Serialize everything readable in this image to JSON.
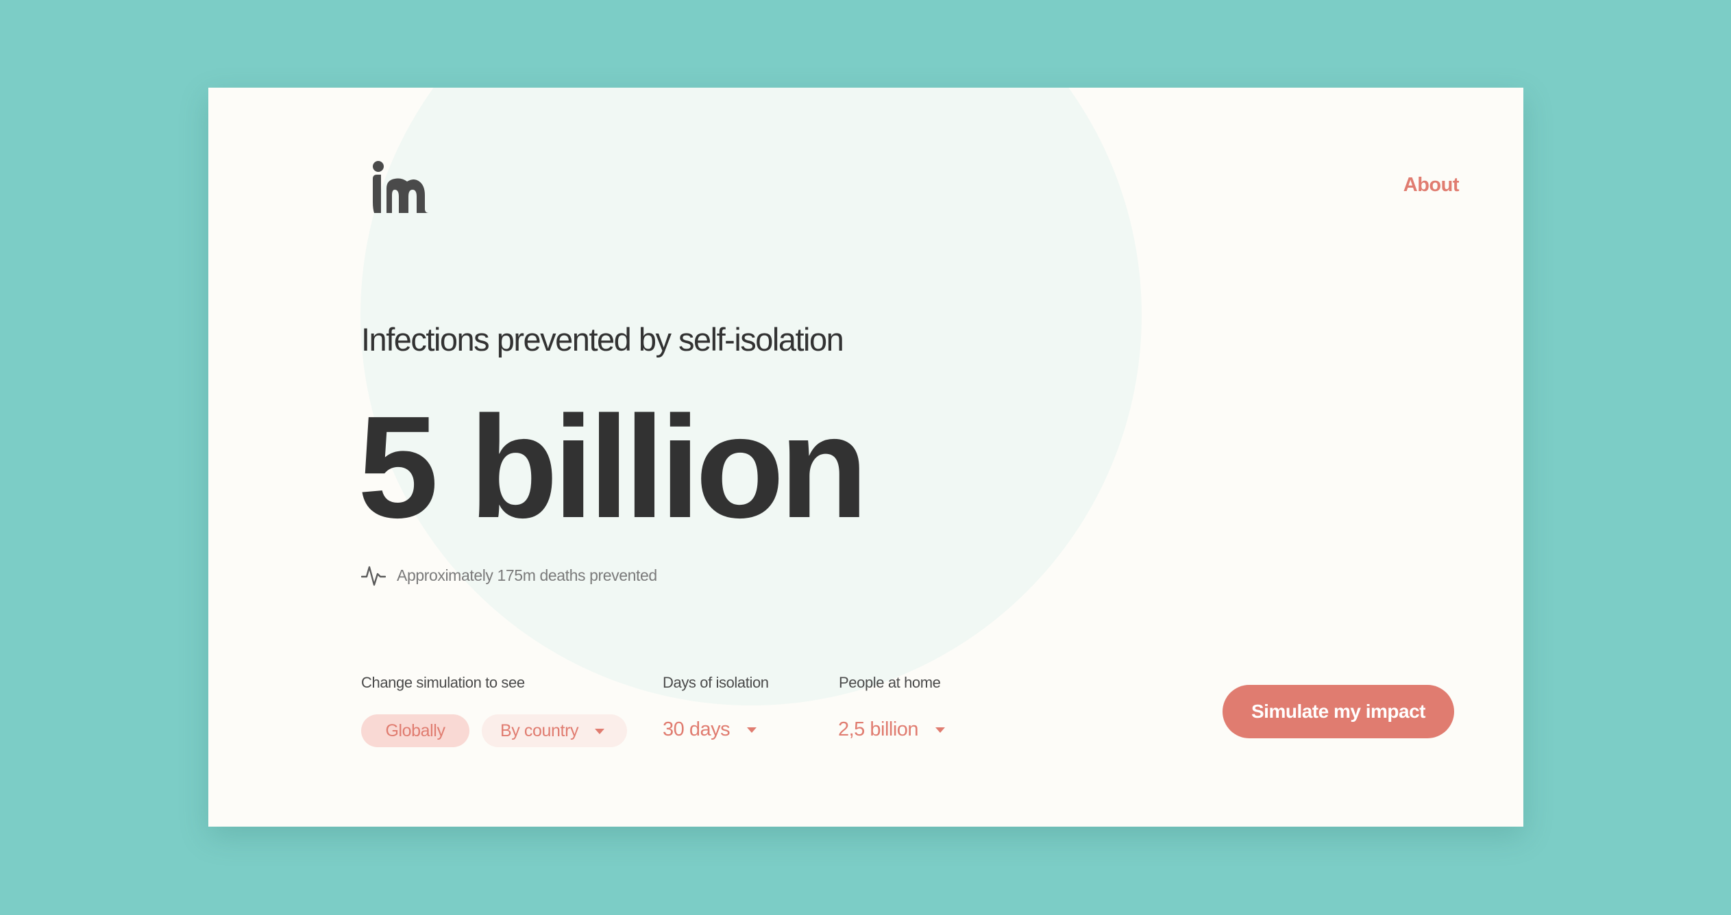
{
  "app": {
    "logo_text": "in",
    "nav": {
      "about_label": "About"
    }
  },
  "hero": {
    "headline": "Infections prevented by self-isolation",
    "big_number": "5 billion",
    "deaths_text": "Approximately 175m deaths prevented"
  },
  "controls": {
    "scope_label": "Change simulation to see",
    "scope_options": [
      "Globally",
      "By country"
    ],
    "scope_selected": "Globally",
    "days_label": "Days of isolation",
    "days_value": "30 days",
    "people_label": "People at home",
    "people_value": "2,5 billion"
  },
  "cta": {
    "label": "Simulate my impact"
  },
  "colors": {
    "background": "#7ccdc6",
    "card": "#fdfcf8",
    "circle": "#f1f8f4",
    "accent": "#e07c70",
    "text": "#323232"
  },
  "icons": {
    "logo": "in-logo-icon",
    "pulse": "pulse-icon",
    "caret": "caret-down-icon"
  }
}
